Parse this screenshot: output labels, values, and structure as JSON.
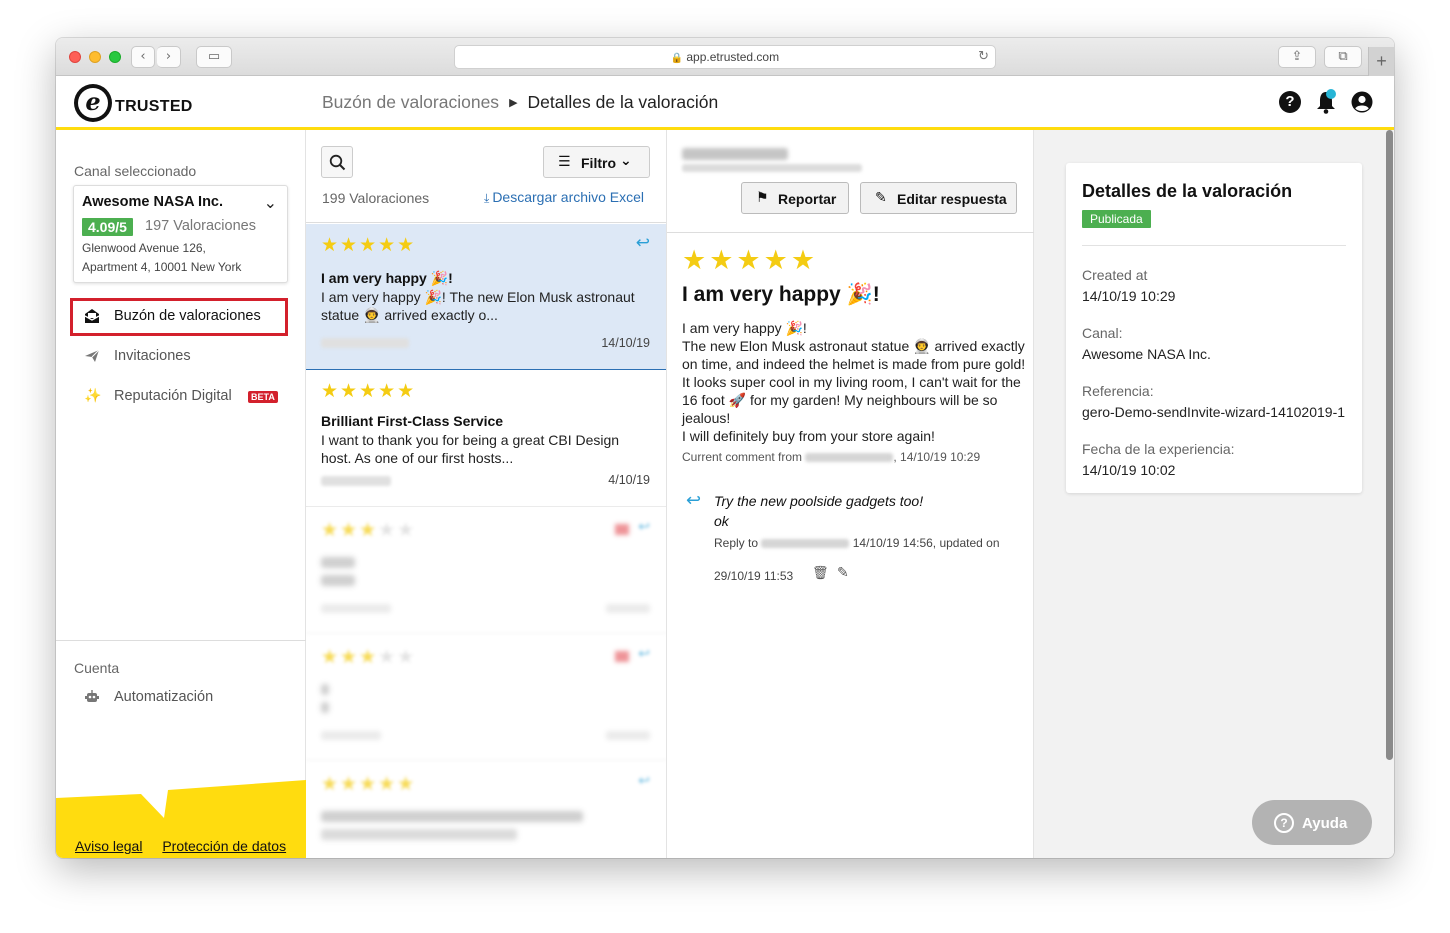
{
  "browser": {
    "url": "app.etrusted.com"
  },
  "header": {
    "logo_letter": "e",
    "logo_text": "TRUSTED",
    "breadcrumb_parent": "Buzón de valoraciones",
    "breadcrumb_current": "Detalles de la valoración",
    "help_icon": "?",
    "accent_color": "#ffdc0f"
  },
  "sidebar": {
    "channel_label": "Canal seleccionado",
    "channel": {
      "name": "Awesome NASA Inc.",
      "score": "4.09/5",
      "review_count": "197 Valoraciones",
      "address_line1": "Glenwood Avenue 126,",
      "address_line2": "Apartment 4, 10001 New York"
    },
    "nav": [
      {
        "label": "Buzón de valoraciones",
        "icon": "inbox-icon",
        "active": true
      },
      {
        "label": "Invitaciones",
        "icon": "paper-plane-icon",
        "active": false
      },
      {
        "label": "Reputación Digital",
        "icon": "sparkle-icon",
        "active": false,
        "badge": "BETA"
      }
    ],
    "account_label": "Cuenta",
    "account_nav": [
      {
        "label": "Automatización",
        "icon": "robot-icon"
      }
    ],
    "footer_links": [
      "Aviso legal",
      "Protección de datos"
    ]
  },
  "list": {
    "filter_label": "Filtro",
    "count_label": "199 Valoraciones",
    "download_label": "Descargar archivo Excel",
    "reviews": [
      {
        "stars": 5,
        "title": "I am very happy 🎉!",
        "body": "I am very happy 🎉! The new Elon Musk astronaut statue 👨‍🚀 arrived exactly o...",
        "date": "14/10/19",
        "selected": true,
        "replied": true
      },
      {
        "stars": 5,
        "title": "Brilliant First-Class Service",
        "body": "I want to thank you for being a great CBI Design host. As one of our first hosts...",
        "date": "4/10/19",
        "selected": false,
        "replied": false
      },
      {
        "stars": 3,
        "title": "",
        "body": "",
        "date": "",
        "selected": false,
        "replied": true
      },
      {
        "stars": 3,
        "title": "",
        "body": "",
        "date": "",
        "selected": false,
        "replied": true
      },
      {
        "stars": 5,
        "title": "",
        "body": "",
        "date": "",
        "selected": false,
        "replied": true
      }
    ]
  },
  "detail": {
    "report_label": "Reportar",
    "edit_reply_label": "Editar respuesta",
    "stars": 5,
    "title": "I am very happy 🎉!",
    "body_lines": [
      "I am very happy 🎉!",
      "The new Elon Musk astronaut statue 👨‍🚀 arrived exactly on time, and indeed the helmet is made from pure gold! It looks super cool in my living room, I can't wait for the 16 foot 🚀 for my garden! My neighbours will be so jealous!",
      "I will definitely buy from your store again!"
    ],
    "comment_prefix": "Current comment from",
    "comment_time": ", 14/10/19 10:29",
    "reply_line1": "Try the new poolside gadgets too!",
    "reply_line2": "ok",
    "reply_to_label": "Reply to",
    "reply_time": "14/10/19 14:56, updated on",
    "reply_updated": "29/10/19 11:53"
  },
  "info": {
    "title": "Detalles de la valoración",
    "status": "Publicada",
    "fields": [
      {
        "label": "Created at",
        "value": "14/10/19 10:29"
      },
      {
        "label": "Canal:",
        "value": "Awesome NASA Inc."
      },
      {
        "label": "Referencia:",
        "value": "gero-Demo-sendInvite-wizard-14102019-1"
      },
      {
        "label": "Fecha de la experiencia:",
        "value": "14/10/19 10:02"
      }
    ],
    "help_label": "Ayuda"
  }
}
